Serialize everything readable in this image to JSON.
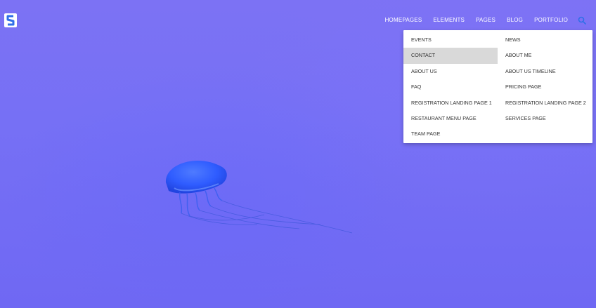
{
  "nav": {
    "items": [
      "HOMEPAGES",
      "ELEMENTS",
      "PAGES",
      "BLOG",
      "PORTFOLIO"
    ]
  },
  "dropdown": {
    "left_items": [
      "EVENTS",
      "CONTACT",
      "ABOUT US",
      "FAQ",
      "REGISTRATION LANDING PAGE 1",
      "RESTAURANT MENU PAGE",
      "TEAM PAGE"
    ],
    "right_items": [
      "NEWS",
      "ABOUT ME",
      "ABOUT US TIMELINE",
      "PRICING PAGE",
      "REGISTRATION LANDING PAGE 2",
      "SERVICES PAGE"
    ],
    "active_item": "CONTACT"
  },
  "icons": {
    "logo": "s-logo-icon",
    "search": "search-icon",
    "hero": "jellyfish-image"
  },
  "colors": {
    "background": "#7670f5",
    "search_icon": "#2f6fe8",
    "dropdown_bg": "#ffffff",
    "active_item_bg": "#d9d9d9",
    "jellyfish": "#2f5cff"
  }
}
